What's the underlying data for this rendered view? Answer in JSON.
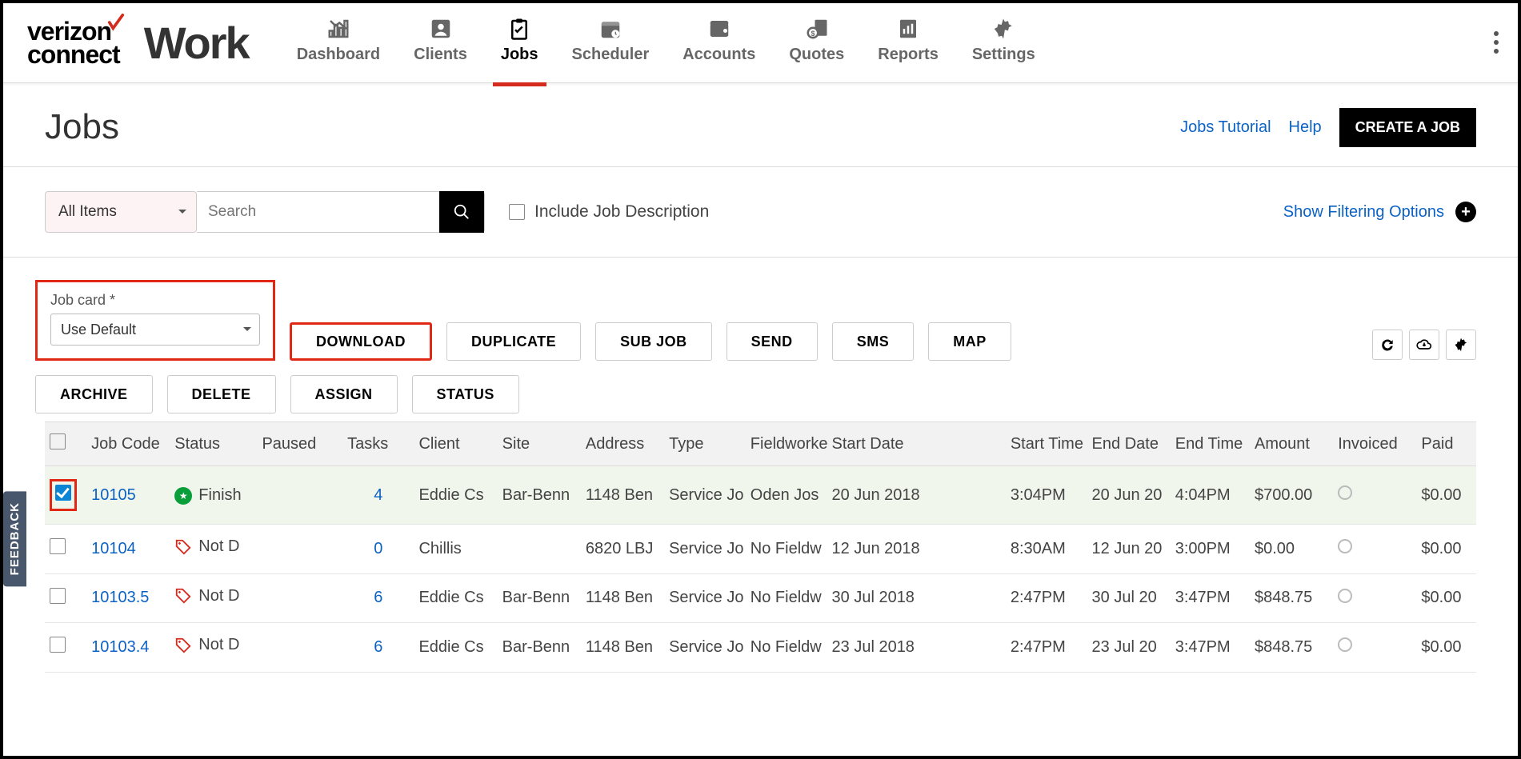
{
  "brand": {
    "line1": "verizon",
    "line2": "connect",
    "product": "Work"
  },
  "nav": [
    {
      "label": "Dashboard",
      "active": false
    },
    {
      "label": "Clients",
      "active": false
    },
    {
      "label": "Jobs",
      "active": true
    },
    {
      "label": "Scheduler",
      "active": false
    },
    {
      "label": "Accounts",
      "active": false
    },
    {
      "label": "Quotes",
      "active": false
    },
    {
      "label": "Reports",
      "active": false
    },
    {
      "label": "Settings",
      "active": false
    }
  ],
  "page": {
    "title": "Jobs",
    "tutorial_link": "Jobs Tutorial",
    "help_link": "Help",
    "create_btn": "CREATE A JOB"
  },
  "filter": {
    "scope": "All Items",
    "search_placeholder": "Search",
    "include_desc_label": "Include Job Description",
    "show_opts": "Show Filtering Options"
  },
  "jobcard": {
    "label": "Job card *",
    "value": "Use Default"
  },
  "actions": {
    "download": "DOWNLOAD",
    "duplicate": "DUPLICATE",
    "subjob": "SUB JOB",
    "send": "SEND",
    "sms": "SMS",
    "map": "MAP",
    "archive": "ARCHIVE",
    "delete": "DELETE",
    "assign": "ASSIGN",
    "status": "STATUS"
  },
  "columns": [
    "",
    "Job Code",
    "Status",
    "Paused",
    "Tasks",
    "Client",
    "Site",
    "Address",
    "Type",
    "Fieldworker",
    "Start Date",
    "Start Time",
    "End Date",
    "End Time",
    "Amount",
    "Invoiced",
    "Paid"
  ],
  "rows": [
    {
      "checked": true,
      "code": "10105",
      "status": "Finish",
      "status_kind": "finish",
      "tasks": "4",
      "client": "Eddie Cs",
      "site": "Bar-Benn",
      "address": "1148 Ben",
      "type": "Service Jo",
      "fw": "Oden Jos",
      "sdate": "20 Jun 2018",
      "stime": "3:04PM",
      "edate": "20 Jun 20",
      "etime": "4:04PM",
      "amount": "$700.00",
      "paid": "$0.00"
    },
    {
      "checked": false,
      "code": "10104",
      "status": "Not D",
      "status_kind": "notd",
      "tasks": "0",
      "client": "Chillis",
      "site": "",
      "address": "6820 LBJ",
      "type": "Service Jo",
      "fw": "No Fieldw",
      "sdate": "12 Jun 2018",
      "stime": "8:30AM",
      "edate": "12 Jun 20",
      "etime": "3:00PM",
      "amount": "$0.00",
      "paid": "$0.00"
    },
    {
      "checked": false,
      "code": "10103.5",
      "status": "Not D",
      "status_kind": "notd",
      "tasks": "6",
      "client": "Eddie Cs",
      "site": "Bar-Benn",
      "address": "1148 Ben",
      "type": "Service Jo",
      "fw": "No Fieldw",
      "sdate": "30 Jul 2018",
      "stime": "2:47PM",
      "edate": "30 Jul 20",
      "etime": "3:47PM",
      "amount": "$848.75",
      "paid": "$0.00"
    },
    {
      "checked": false,
      "code": "10103.4",
      "status": "Not D",
      "status_kind": "notd",
      "tasks": "6",
      "client": "Eddie Cs",
      "site": "Bar-Benn",
      "address": "1148 Ben",
      "type": "Service Jo",
      "fw": "No Fieldw",
      "sdate": "23 Jul 2018",
      "stime": "2:47PM",
      "edate": "23 Jul 20",
      "etime": "3:47PM",
      "amount": "$848.75",
      "paid": "$0.00"
    }
  ],
  "feedback_label": "FEEDBACK"
}
